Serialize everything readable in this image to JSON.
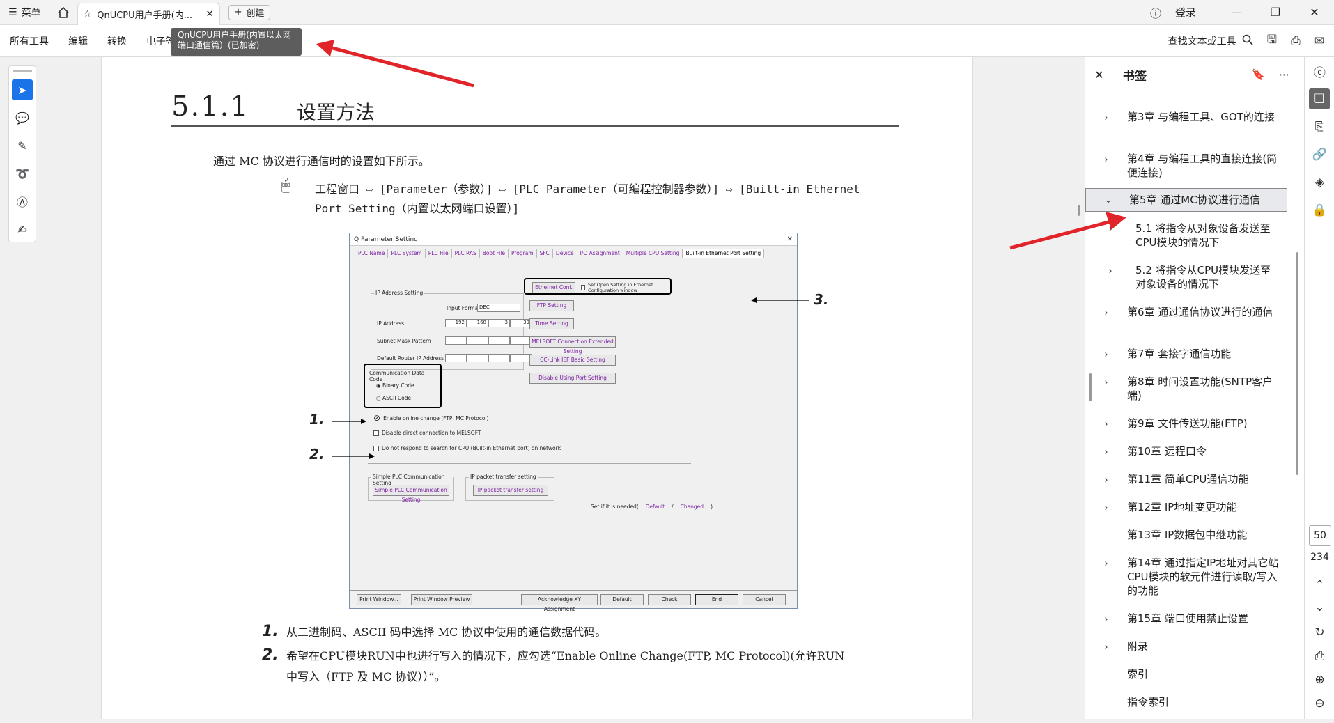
{
  "titlebar": {
    "menu_label": "菜单",
    "tab_title": "QnUCPU用户手册(内...",
    "new_tab_label": "创建",
    "login_label": "登录"
  },
  "menubar": {
    "items": [
      "所有工具",
      "编辑",
      "转换",
      "电子签名"
    ],
    "find_label": "查找文本或工具"
  },
  "tooltip": {
    "line1": "QnUCPU用户手册(内置以太网",
    "line2": "端口通信篇）(已加密)"
  },
  "document": {
    "section_number": "5.1.1",
    "section_title": "设置方法",
    "intro": "通过 MC 协议进行通信时的设置如下所示。",
    "path_text": "工程窗口 ⇨ [Parameter（参数）] ⇨ [PLC Parameter（可编程控制器参数）] ⇨ [Built-in Ethernet Port Setting（内置以太网端口设置）]",
    "screenshot": {
      "title": "Q Parameter Setting",
      "tabs": [
        "PLC Name",
        "PLC System",
        "PLC File",
        "PLC RAS",
        "Boot File",
        "Program",
        "SFC",
        "Device",
        "I/O Assignment",
        "Multiple CPU Setting",
        "Built-in Ethernet Port Setting"
      ],
      "ip_group": "IP Address Setting",
      "input_format_label": "Input Format",
      "input_format_value": "DEC",
      "ip_address_label": "IP Address",
      "ip_values": [
        "192",
        "168",
        "3",
        "39"
      ],
      "subnet_label": "Subnet Mask Pattern",
      "router_label": "Default Router IP Address",
      "comm_group": "Communication Data Code",
      "binary": "Binary Code",
      "ascii": "ASCII Code",
      "enable_online": "Enable online change (FTP, MC Protocol)",
      "disable_direct": "Disable direct connection to MELSOFT",
      "no_respond": "Do not respond to search for CPU (Built-in Ethernet port) on network",
      "eth_conf_btn": "Ethernet Conf.",
      "open_setting": "Set Open Setting in Ethernet Configuration window",
      "ftp_btn": "FTP Setting",
      "time_btn": "Time Setting",
      "melsoft_btn": "MELSOFT Connection Extended Setting",
      "cclink_btn": "CC-Link IEF Basic Setting",
      "disable_port_btn": "Disable Using Port Setting",
      "simple_group": "Simple PLC Communication Setting",
      "simple_btn": "Simple PLC Communication Setting",
      "packet_group": "IP packet transfer setting",
      "packet_btn": "IP packet transfer setting",
      "set_if_needed": "Set if it is needed(",
      "default_word": "Default",
      "slash": "/",
      "changed_word": "Changed",
      "close_paren": ")",
      "bottom_buttons": [
        "Print Window...",
        "Print Window Preview",
        "Acknowledge XY Assignment",
        "Default",
        "Check",
        "End",
        "Cancel"
      ],
      "callouts": [
        "1.",
        "2.",
        "3."
      ]
    },
    "steps": [
      {
        "num": "1.",
        "text": "从二进制码、ASCII 码中选择 MC 协议中使用的通信数据代码。"
      },
      {
        "num": "2.",
        "text_line1": "希望在CPU模块RUN中也进行写入的情况下，应勾选“Enable Online Change(FTP, MC Protocol)(允许RUN",
        "text_line2": "中写入（FTP 及 MC 协议））”。"
      }
    ]
  },
  "bookmarks": {
    "title": "书签",
    "items": [
      {
        "label": "第3章 与编程工具、GOT的连接",
        "arrow": "›"
      },
      {
        "label": "第4章 与编程工具的直接连接(简便连接)",
        "arrow": "›"
      },
      {
        "label": "第5章 通过MC协议进行通信",
        "arrow": "⌄"
      },
      {
        "label": "5.1 将指令从对象设备发送至CPU模块的情况下",
        "arrow": "›"
      },
      {
        "label": "5.2 将指令从CPU模块发送至对象设备的情况下",
        "arrow": "›"
      },
      {
        "label": "第6章 通过通信协议进行的通信",
        "arrow": "›"
      },
      {
        "label": "第7章 套接字通信功能",
        "arrow": "›"
      },
      {
        "label": "第8章 时间设置功能(SNTP客户端)",
        "arrow": "›"
      },
      {
        "label": "第9章 文件传送功能(FTP)",
        "arrow": "›"
      },
      {
        "label": "第10章 远程口令",
        "arrow": "›"
      },
      {
        "label": "第11章 简单CPU通信功能",
        "arrow": "›"
      },
      {
        "label": "第12章 IP地址变更功能",
        "arrow": "›"
      },
      {
        "label": "第13章 IP数据包中继功能",
        "arrow": ""
      },
      {
        "label": "第14章 通过指定IP地址对其它站CPU模块的软元件进行读取/写入的功能",
        "arrow": "›"
      },
      {
        "label": "第15章 端口使用禁止设置",
        "arrow": "›"
      },
      {
        "label": "附录",
        "arrow": "›"
      },
      {
        "label": "索引",
        "arrow": ""
      },
      {
        "label": "指令索引",
        "arrow": ""
      }
    ]
  },
  "pagination": {
    "current": "50",
    "total": "234"
  },
  "colors": {
    "accent": "#1a73e8",
    "annotation_arrow": "#e0242a",
    "link_purple": "#7b1fa2"
  }
}
